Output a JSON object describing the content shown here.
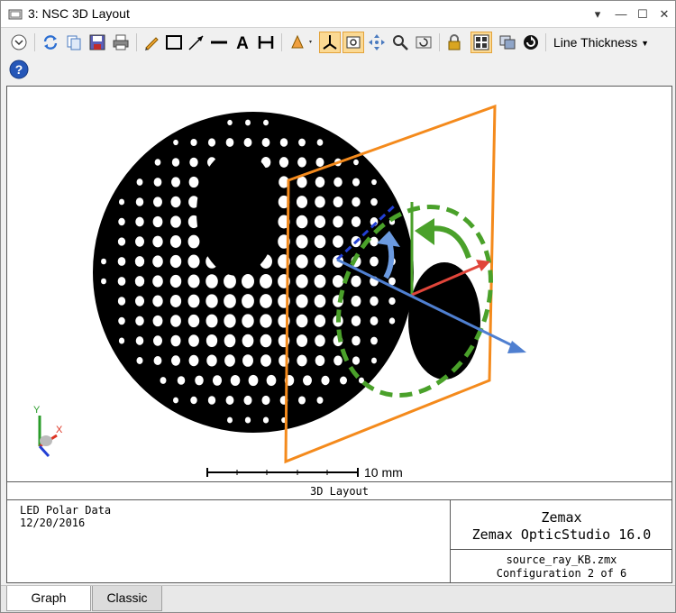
{
  "window": {
    "title": "3: NSC 3D Layout",
    "controls": [
      "chevron-down",
      "minimize",
      "maximize",
      "close"
    ]
  },
  "toolbar": {
    "icons": [
      "settings-chevron",
      "refresh",
      "copy",
      "save",
      "print",
      "pencil",
      "rectangle",
      "arrow-line",
      "line",
      "text",
      "dimension",
      "rotate",
      "axis",
      "rotate-view",
      "pan",
      "zoom",
      "reset-view",
      "lock",
      "window-layout",
      "clone-window",
      "auto-update"
    ],
    "line_thickness_label": "Line Thickness",
    "help_icon": "help-icon"
  },
  "graph": {
    "scale_label": "10 mm",
    "plot_title": "3D Layout",
    "axes": {
      "y": "Y",
      "x": "X"
    },
    "colors": {
      "sphere": "#000000",
      "plane": "#f48a1c",
      "circle": "#4aa12a",
      "arrow_red": "#e0453a",
      "arrow_blue": "#4f7fd0",
      "axis_dashed": "#2340d4"
    }
  },
  "info": {
    "left_line1": "LED Polar Data",
    "left_line2": "12/20/2016",
    "right_line1": "Zemax",
    "right_line2": "Zemax OpticStudio 16.0",
    "file_name": "source_ray_KB.zmx",
    "configuration": "Configuration 2 of 6"
  },
  "tabs": [
    "Graph",
    "Classic"
  ]
}
